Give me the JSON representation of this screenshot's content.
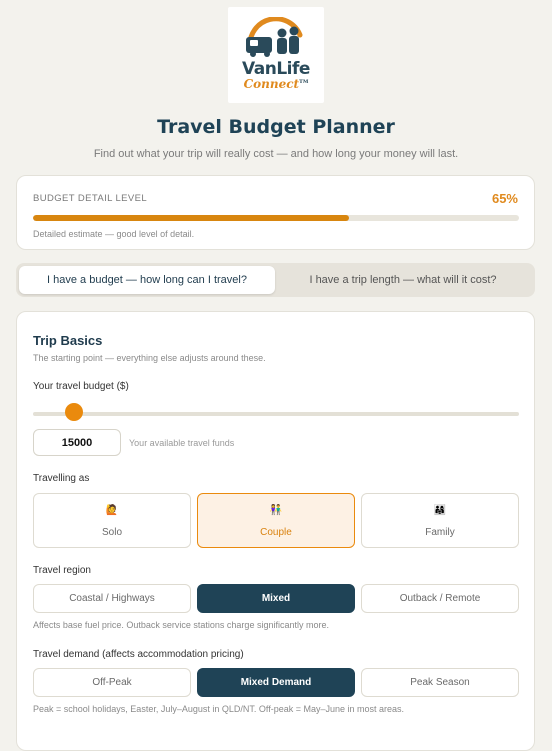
{
  "brand": {
    "name_part1": "VanLife",
    "name_part2": "Connect",
    "trademark": "TM",
    "logo_icon": "van-and-people-icon",
    "colors": {
      "teal": "#2a4a5a",
      "orange": "#e08a1e"
    }
  },
  "header": {
    "title": "Travel Budget Planner",
    "subtitle": "Find out what your trip will really cost — and how long your money will last."
  },
  "detail_level": {
    "label": "BUDGET DETAIL LEVEL",
    "percent_text": "65%",
    "progress": 0.65,
    "note": "Detailed estimate — good level of detail."
  },
  "mode_tabs": [
    {
      "label": "I have a budget — how long can I travel?",
      "active": true
    },
    {
      "label": "I have a trip length — what will it cost?",
      "active": false
    }
  ],
  "trip_basics": {
    "title": "Trip Basics",
    "subtitle": "The starting point — everything else adjusts around these.",
    "budget": {
      "label": "Your travel budget ($)",
      "value": "15000",
      "slider_fraction": 0.085,
      "hint": "Your available travel funds"
    },
    "travelling_as": {
      "label": "Travelling as",
      "options": [
        {
          "label": "Solo",
          "icon": "solo-person-icon",
          "emoji": "🙋",
          "selected": false
        },
        {
          "label": "Couple",
          "icon": "couple-icon",
          "emoji": "👫",
          "selected": true
        },
        {
          "label": "Family",
          "icon": "family-icon",
          "emoji": "👨‍👩‍👧",
          "selected": false
        }
      ]
    },
    "region": {
      "label": "Travel region",
      "options": [
        {
          "label": "Coastal / Highways",
          "selected": false
        },
        {
          "label": "Mixed",
          "selected": true
        },
        {
          "label": "Outback / Remote",
          "selected": false
        }
      ],
      "note": "Affects base fuel price. Outback service stations charge significantly more."
    },
    "demand": {
      "label": "Travel demand (affects accommodation pricing)",
      "options": [
        {
          "label": "Off-Peak",
          "selected": false
        },
        {
          "label": "Mixed Demand",
          "selected": true
        },
        {
          "label": "Peak Season",
          "selected": false
        }
      ],
      "note": "Peak = school holidays, Easter, July–August in QLD/NT. Off-peak = May–June in most areas."
    }
  }
}
